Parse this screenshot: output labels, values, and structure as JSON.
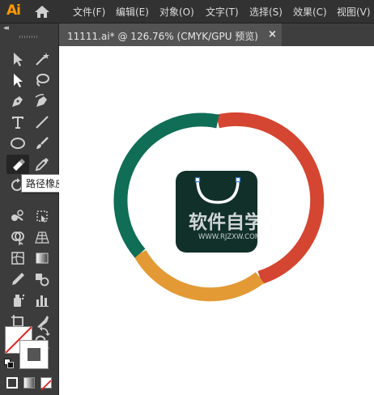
{
  "app": {
    "logo": "Ai"
  },
  "menu": [
    {
      "label": "文件(F)"
    },
    {
      "label": "编辑(E)"
    },
    {
      "label": "对象(O)"
    },
    {
      "label": "文字(T)"
    },
    {
      "label": "选择(S)"
    },
    {
      "label": "效果(C)"
    },
    {
      "label": "视图(V)"
    }
  ],
  "toolbar": {
    "collapse": "◂◂",
    "tooltip": "路径橡皮擦工具",
    "tools": [
      "selection-tool",
      "direct-selection-tool",
      "magic-wand-tool",
      "lasso-tool",
      "pen-tool",
      "curvature-tool",
      "type-tool",
      "line-tool",
      "ellipse-tool",
      "paintbrush-tool",
      "path-eraser-tool",
      "eyedropper-tool",
      "rotate-tool",
      "scale-tool",
      "puppet-warp-tool",
      "free-transform-tool",
      "shape-builder-tool",
      "perspective-grid-tool",
      "mesh-tool",
      "gradient-tool",
      "eyedropper-tool-2",
      "blend-tool",
      "symbol-sprayer-tool",
      "column-graph-tool",
      "artboard-tool",
      "slice-tool",
      "hand-tool",
      "zoom-tool"
    ]
  },
  "document": {
    "tab_title": "11111.ai* @ 126.76% (CMYK/GPU 预览)",
    "close": "×"
  },
  "artwork": {
    "ring_colors": {
      "red": "#d44631",
      "orange": "#e39a34",
      "green": "#0f6e55"
    },
    "tile_color": "#11302a",
    "bag_stroke": "#ffffff",
    "anchor_color": "#2f7ddf",
    "watermark_title": "软件自学网",
    "watermark_url": "WWW.RJZXW.COM"
  }
}
